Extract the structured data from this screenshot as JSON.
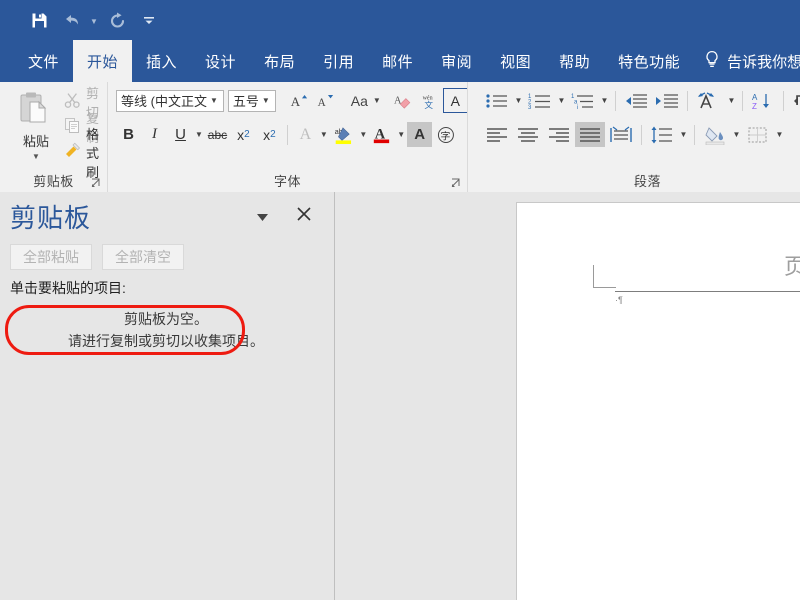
{
  "quick_access": {
    "items": [
      {
        "name": "save",
        "icon": "floppy-disk-icon"
      },
      {
        "name": "undo",
        "icon": "undo-arrow-icon"
      },
      {
        "name": "redo",
        "icon": "redo-arrow-icon"
      },
      {
        "name": "customize",
        "icon": "customize-qat-icon"
      }
    ]
  },
  "ribbon": {
    "tabs": [
      {
        "label": "文件",
        "active": false
      },
      {
        "label": "开始",
        "active": true
      },
      {
        "label": "插入",
        "active": false
      },
      {
        "label": "设计",
        "active": false
      },
      {
        "label": "布局",
        "active": false
      },
      {
        "label": "引用",
        "active": false
      },
      {
        "label": "邮件",
        "active": false
      },
      {
        "label": "审阅",
        "active": false
      },
      {
        "label": "视图",
        "active": false
      },
      {
        "label": "帮助",
        "active": false
      },
      {
        "label": "特色功能",
        "active": false
      }
    ],
    "tell_me": "告诉我你想要",
    "groups": {
      "clipboard": {
        "label": "剪贴板",
        "paste": "粘贴",
        "cut": "剪切",
        "copy": "复制",
        "format_painter": "格式刷"
      },
      "font": {
        "label": "字体",
        "font_name": "等线 (中文正文",
        "font_size": "五号",
        "grow_font": "A",
        "shrink_font": "A",
        "change_case": "Aa",
        "clear_formatting": "A",
        "phonetic_guide": "文",
        "char_border": "A",
        "bold": "B",
        "italic": "I",
        "underline": "U",
        "strikethrough": "abc",
        "subscript": "x",
        "subscript_idx": "2",
        "superscript": "x",
        "superscript_idx": "2",
        "text_effects": "A",
        "highlight": "ab",
        "font_color": "A",
        "char_shading": "A",
        "enclose_chars": "字"
      },
      "paragraph": {
        "label": "段落"
      }
    }
  },
  "clipboard_pane": {
    "title": "剪贴板",
    "paste_all": "全部粘贴",
    "clear_all": "全部清空",
    "hint": "单击要粘贴的项目:",
    "empty_line1": "剪贴板为空。",
    "empty_line2": "请进行复制或剪切以收集项目。"
  },
  "document": {
    "header_text": "页眉"
  },
  "colors": {
    "ribbon_blue": "#2b579a",
    "ribbon_bg": "#f1f1f1",
    "workspace_gray": "#e6e6e6",
    "annotation_red": "#ee1b11",
    "highlight_yellow": "#ffff00",
    "font_color_red": "#e00000"
  }
}
